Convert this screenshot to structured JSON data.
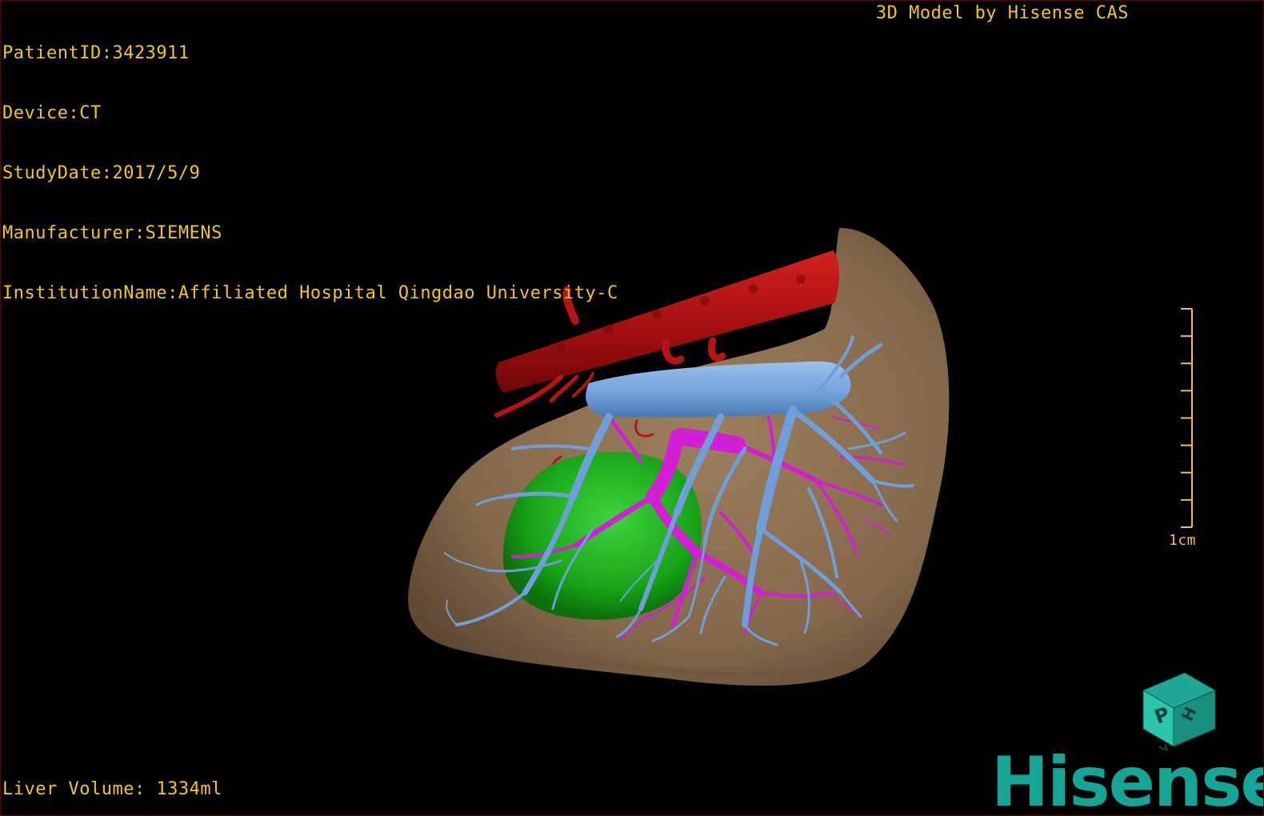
{
  "meta": {
    "patient_id": "PatientID:3423911",
    "device": "Device:CT",
    "study_date": "StudyDate:2017/5/9",
    "manufacturer": "Manufacturer:SIEMENS",
    "institution": "InstitutionName:Affiliated Hospital Qingdao University-C"
  },
  "model_credit": "3D Model by Hisense CAS",
  "liver_volume": "Liver Volume: 1334ml",
  "scale_bar": {
    "label": "1cm",
    "tick_count": 9
  },
  "orientation_cube": {
    "front_label": "P",
    "right_label": "H",
    "bottom_label": "R"
  },
  "brand": "Hisense",
  "colors": {
    "overlay_text": "#f5c518",
    "liver": "#8b6f4e",
    "artery": "#b01010",
    "vein": "#6f9fd8",
    "portal_vein": "#d21fd6",
    "tumor": "#1fb81f",
    "brand": "#13a596"
  }
}
